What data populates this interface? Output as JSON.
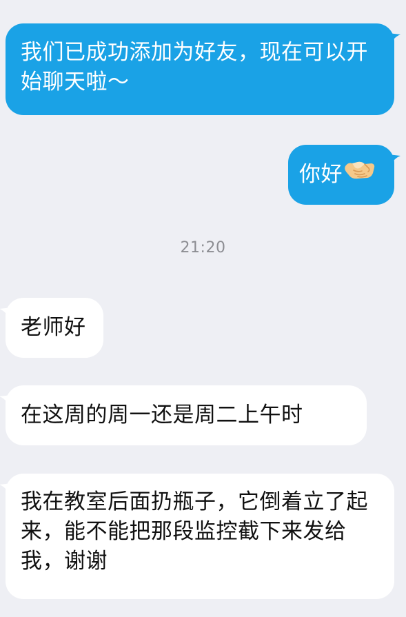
{
  "conversation": {
    "messages": [
      {
        "from": "me",
        "text": "我们已成功添加为好友，现在可以开始聊天啦～"
      },
      {
        "from": "me",
        "text": "你好",
        "emoji": "handshake-emoji"
      },
      {
        "from": "other",
        "text": "老师好"
      },
      {
        "from": "other",
        "text": "在这周的周一还是周二上午时"
      },
      {
        "from": "other",
        "text": "我在教室后面扔瓶子，它倒着立了起来，能不能把那段监控截下来发给我，谢谢"
      }
    ],
    "timestamp": "21:20"
  },
  "colors": {
    "background": "#eeeff4",
    "sent_bubble": "#1aa2e6",
    "received_bubble": "#ffffff",
    "timestamp_text": "#8c8d92"
  }
}
